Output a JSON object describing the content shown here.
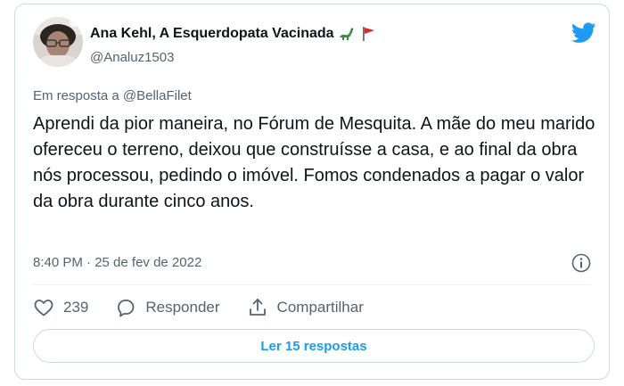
{
  "author": {
    "display_name": "Ana Kehl, A Esquerdopata Vacinada",
    "handle": "@Analuz1503"
  },
  "reply_to": "Em resposta a @BellaFilet",
  "tweet": {
    "text": "Aprendi da pior maneira, no Fórum de Mesquita. A mãe do meu marido ofereceu o terreno, deixou que construísse a casa, e ao final da obra nós processou, pedindo o imóvel. Fomos condenados a pagar o valor da obra durante cinco anos.",
    "timestamp": "8:40 PM · 25 de fev de 2022"
  },
  "actions": {
    "like_count": "239",
    "reply_label": "Responder",
    "share_label": "Compartilhar"
  },
  "read_replies_label": "Ler 15 respostas",
  "icons": {
    "brand": "twitter-bird-icon",
    "emoji_1": "sauropod-emoji-icon",
    "emoji_2": "red-flag-emoji-icon",
    "info": "info-icon",
    "like": "heart-icon",
    "reply": "speech-bubble-icon",
    "share": "share-upload-icon"
  },
  "colors": {
    "accent": "#1d9bf0",
    "secondary_text": "#536471",
    "primary_text": "#0f1419",
    "border": "#cfd9de"
  }
}
